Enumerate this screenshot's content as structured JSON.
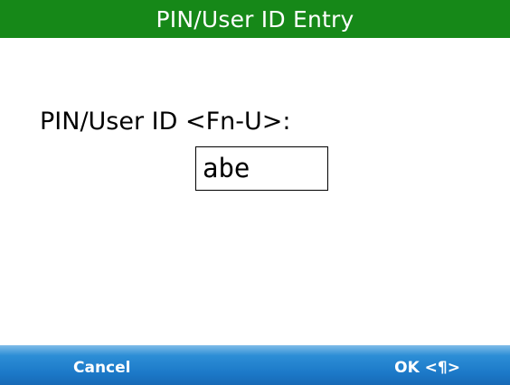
{
  "window": {
    "title": "PIN/User ID Entry"
  },
  "form": {
    "pin_label": "PIN/User ID <Fn-U>:",
    "pin_value": "abe"
  },
  "softkeys": {
    "left_label": "Cancel",
    "right_label": "OK <¶>"
  },
  "colors": {
    "title_bar": "#168818",
    "softkey_bar": "#1c79c8",
    "text": "#000000",
    "softkey_text": "#ffffff"
  }
}
